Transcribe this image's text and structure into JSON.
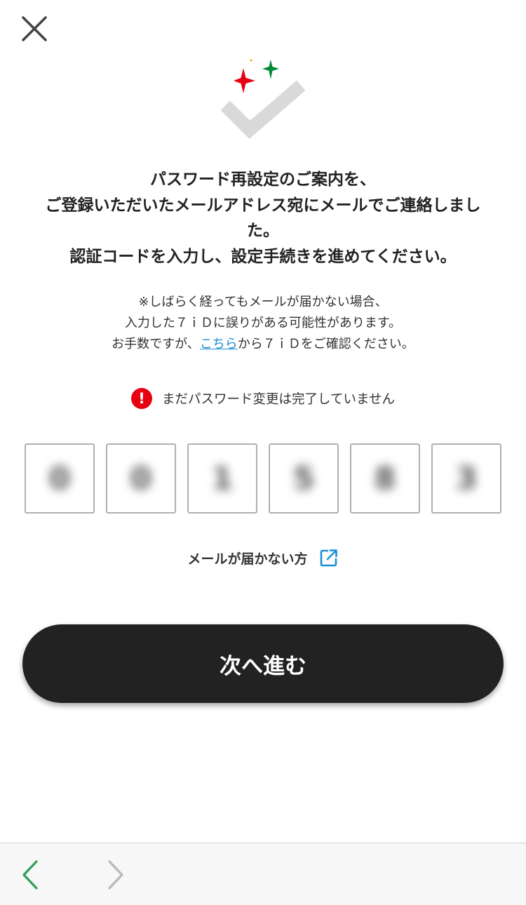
{
  "header": {
    "close_icon": "close-icon"
  },
  "hero": {
    "icon": "checkmark-sparkle-icon",
    "colors": {
      "check": "#d9d9d9",
      "sparkle_red": "#e60012",
      "sparkle_green": "#008a3a",
      "sparkle_yellow": "#f2a900"
    }
  },
  "message": {
    "lines": [
      "パスワード再設定のご案内を、",
      "ご登録いただいたメールアドレス宛にメールでご連絡しまし",
      "た。",
      "認証コードを入力し、設定手続きを進めてください。"
    ]
  },
  "notice": {
    "line1": "※しばらく経ってもメールが届かない場合、",
    "line2": "入力した７ｉＤに誤りがある可能性があります。",
    "line3_before": "お手数ですが、",
    "line3_link": "こちら",
    "line3_after": "から７ｉＤをご確認ください。",
    "link_color": "#1a8fd6"
  },
  "warning": {
    "icon_text": "!",
    "text": "まだパスワード変更は完了していません",
    "color": "#e60012"
  },
  "code": {
    "digits": [
      "0",
      "0",
      "1",
      "5",
      "8",
      "3"
    ]
  },
  "help": {
    "label": "メールが届かない方",
    "icon": "external-link-icon",
    "icon_color": "#1a8fd6"
  },
  "next_button": {
    "label": "次へ進む",
    "color": "#222222"
  },
  "bottom_nav": {
    "back_icon": "chevron-left-icon",
    "forward_icon": "chevron-right-icon",
    "back_color": "#2e9e5b",
    "forward_color": "#b8b8b8"
  }
}
